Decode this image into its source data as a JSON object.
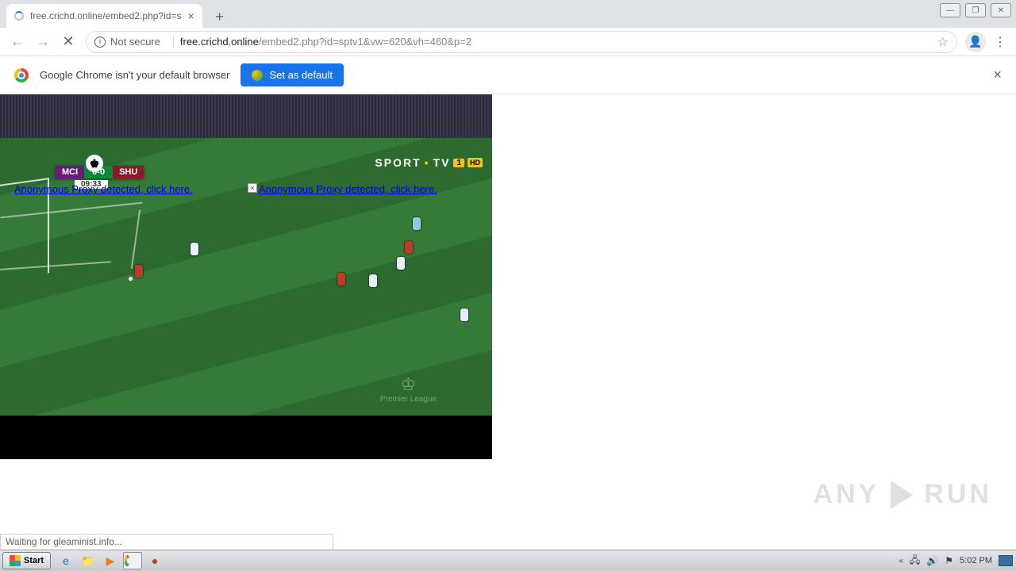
{
  "browser": {
    "tab_title": "free.crichd.online/embed2.php?id=s",
    "security_label": "Not secure",
    "url_host": "free.crichd.online",
    "url_path": "/embed2.php?id=sptv1&vw=620&vh=460&p=2"
  },
  "infobar": {
    "message": "Google Chrome isn't your default browser",
    "button_label": "Set as default"
  },
  "video": {
    "score": {
      "team_a": "MCI",
      "team_b": "SHU",
      "score": "0-0",
      "clock": "09:33"
    },
    "broadcaster": {
      "brand": "SPORT",
      "brand2": "TV",
      "channel": "1",
      "hd": "HD"
    },
    "watermark": "Premier League"
  },
  "ads": {
    "link_text": "Anonymous Proxy detected, click here."
  },
  "status_text": "Waiting for gleaminist.info...",
  "anyrun": {
    "a": "ANY",
    "b": "RUN"
  },
  "taskbar": {
    "start": "Start",
    "clock": "5:02 PM"
  }
}
